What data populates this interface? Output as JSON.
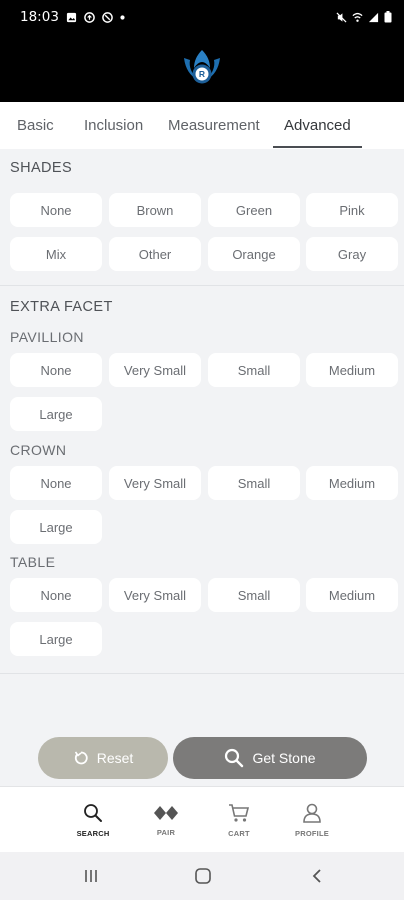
{
  "status_bar": {
    "time": "18:03",
    "left_icons": [
      "image-icon",
      "data-saver-icon",
      "dnd-icon",
      "dot-icon"
    ],
    "right_icons": [
      "mute-icon",
      "wifi-icon",
      "signal-icon",
      "battery-icon"
    ]
  },
  "header": {
    "logo": "lotus-r-logo",
    "logo_letter": "R",
    "accent": "#1e6fb0"
  },
  "tabs": [
    {
      "label": "Basic",
      "active": false
    },
    {
      "label": "Inclusion",
      "active": false
    },
    {
      "label": "Measurement",
      "active": false
    },
    {
      "label": "Advanced",
      "active": true
    }
  ],
  "shades": {
    "title": "SHADES",
    "options": [
      "None",
      "Brown",
      "Green",
      "Pink",
      "Mix",
      "Other",
      "Orange",
      "Gray"
    ]
  },
  "extra_facet": {
    "title": "EXTRA FACET",
    "pavillion": {
      "title": "PAVILLION",
      "options": [
        "None",
        "Very Small",
        "Small",
        "Medium",
        "Large"
      ]
    },
    "crown": {
      "title": "CROWN",
      "options": [
        "None",
        "Very Small",
        "Small",
        "Medium",
        "Large"
      ]
    },
    "table": {
      "title": "TABLE",
      "options": [
        "None",
        "Very Small",
        "Small",
        "Medium",
        "Large"
      ]
    }
  },
  "actions": {
    "reset_label": "Reset",
    "get_stone_label": "Get Stone"
  },
  "bottom_nav": [
    {
      "label": "SEARCH",
      "icon": "search-icon",
      "active": true
    },
    {
      "label": "PAIR",
      "icon": "diamond-pair-icon",
      "active": false
    },
    {
      "label": "CART",
      "icon": "cart-icon",
      "active": false
    },
    {
      "label": "PROFILE",
      "icon": "profile-icon",
      "active": false
    }
  ],
  "system_nav": [
    "recents-icon",
    "home-icon",
    "back-icon"
  ]
}
